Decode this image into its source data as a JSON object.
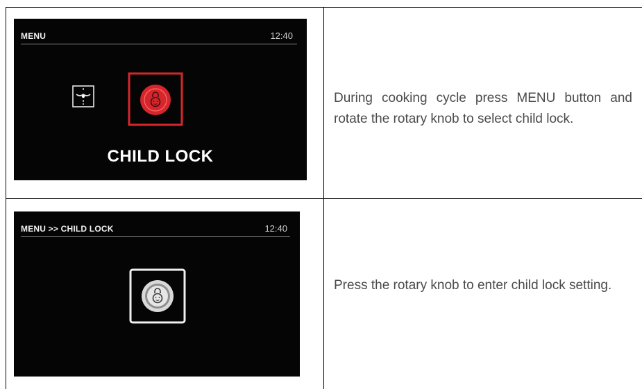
{
  "rows": [
    {
      "screen": {
        "title": "MENU",
        "time": "12:40",
        "caption": "CHILD LOCK",
        "icons": [
          "hob-icon",
          "child-lock-icon"
        ],
        "selected_color": "#d6262c"
      },
      "description": "During cooking cycle press MENU button and rotate the rotary knob to select child lock."
    },
    {
      "screen": {
        "title": "MENU >> CHILD LOCK",
        "time": "12:40",
        "icons": [
          "child-lock-icon"
        ]
      },
      "description": "Press the rotary knob to enter child lock setting."
    }
  ]
}
